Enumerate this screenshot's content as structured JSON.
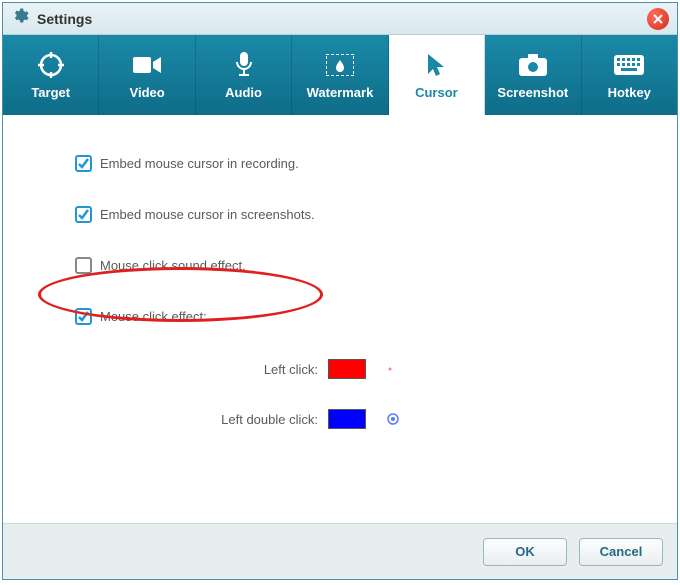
{
  "window": {
    "title": "Settings"
  },
  "tabs": {
    "items": [
      {
        "label": "Target"
      },
      {
        "label": "Video"
      },
      {
        "label": "Audio"
      },
      {
        "label": "Watermark"
      },
      {
        "label": "Cursor"
      },
      {
        "label": "Screenshot"
      },
      {
        "label": "Hotkey"
      }
    ],
    "active_index": 4
  },
  "options": {
    "embed_recording": {
      "label": "Embed mouse cursor in recording.",
      "checked": true
    },
    "embed_screenshots": {
      "label": "Embed mouse cursor in screenshots.",
      "checked": true
    },
    "click_sound": {
      "label": "Mouse click sound effect.",
      "checked": false
    },
    "click_effect": {
      "label": "Mouse click effect:",
      "checked": true
    }
  },
  "colors": {
    "left_click": {
      "label": "Left click:",
      "value": "#ff0000"
    },
    "left_double_click": {
      "label": "Left double click:",
      "value": "#0000ff"
    }
  },
  "footer": {
    "ok": "OK",
    "cancel": "Cancel"
  }
}
